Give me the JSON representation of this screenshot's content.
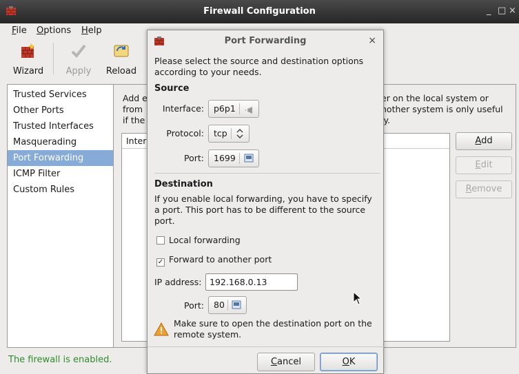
{
  "window": {
    "title": "Firewall Configuration",
    "minimize_glyph": "_",
    "maximize_glyph": "□",
    "close_glyph": "×"
  },
  "menu": [
    {
      "key": "F",
      "rest": "ile"
    },
    {
      "key": "O",
      "rest": "ptions"
    },
    {
      "key": "H",
      "rest": "elp"
    }
  ],
  "toolbar": {
    "wizard": "Wizard",
    "apply": "Apply",
    "reload": "Reload"
  },
  "sidebar": {
    "items": [
      "Trusted Services",
      "Other Ports",
      "Trusted Interfaces",
      "Masquerading",
      "Port Forwarding",
      "ICMP Filter",
      "Custom Rules"
    ],
    "selected": "Port Forwarding"
  },
  "main": {
    "desc_left": [
      "Add e",
      "from",
      "if the"
    ],
    "desc_right": [
      "er on the local system or",
      "nother system is only useful",
      "ly."
    ],
    "table_header_partial": "Inter",
    "buttons": {
      "add_key": "A",
      "add_rest": "dd",
      "edit_key": "E",
      "edit_rest": "dit",
      "remove_key": "R",
      "remove_rest": "emove"
    }
  },
  "status": "The firewall is enabled.",
  "dialog": {
    "title": "Port Forwarding",
    "close_glyph": "×",
    "intro": [
      "Please select the source and destination options",
      "according to your needs."
    ],
    "source": {
      "heading": "Source",
      "interface_label": "Interface:",
      "interface_value": "p6p1",
      "protocol_label": "Protocol:",
      "protocol_value": "tcp",
      "port_label": "Port:",
      "port_value": "1699"
    },
    "destination": {
      "heading": "Destination",
      "text": [
        "If you enable local forwarding, you have to specify",
        "a port. This port has to be different to the source",
        "port."
      ],
      "local_forwarding": "Local forwarding",
      "local_forwarding_checked": false,
      "forward_another": "Forward to another port",
      "forward_another_checked": true,
      "ip_label": "IP address:",
      "ip_value": "192.168.0.13",
      "port_label": "Port:",
      "port_value": "80"
    },
    "warning": [
      "Make sure to open the destination port on the",
      "remote system."
    ],
    "cancel_key": "C",
    "cancel_rest": "ancel",
    "ok_key": "O",
    "ok_rest": "K"
  }
}
